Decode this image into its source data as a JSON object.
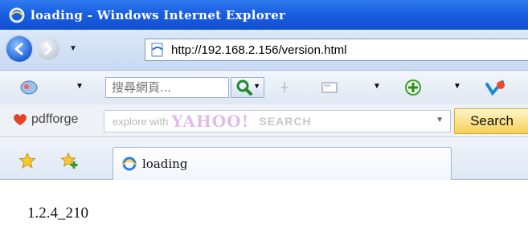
{
  "window": {
    "title": "loading - Windows Internet Explorer"
  },
  "navigation": {
    "address_url": "http://192.168.2.156/version.html"
  },
  "toolbar": {
    "search_placeholder": "搜尋網頁..."
  },
  "pdfforge": {
    "brand": "pdfforge",
    "explore_text": "explore with",
    "yahoo_text": "YAHOO!",
    "search_word": "SEARCH",
    "search_button": "Search"
  },
  "tabs": [
    {
      "label": "loading"
    }
  ],
  "page": {
    "version_text": "1.2.4_210"
  },
  "colors": {
    "titlebar": "#1a5fe0",
    "search_button": "#f6cf57"
  }
}
